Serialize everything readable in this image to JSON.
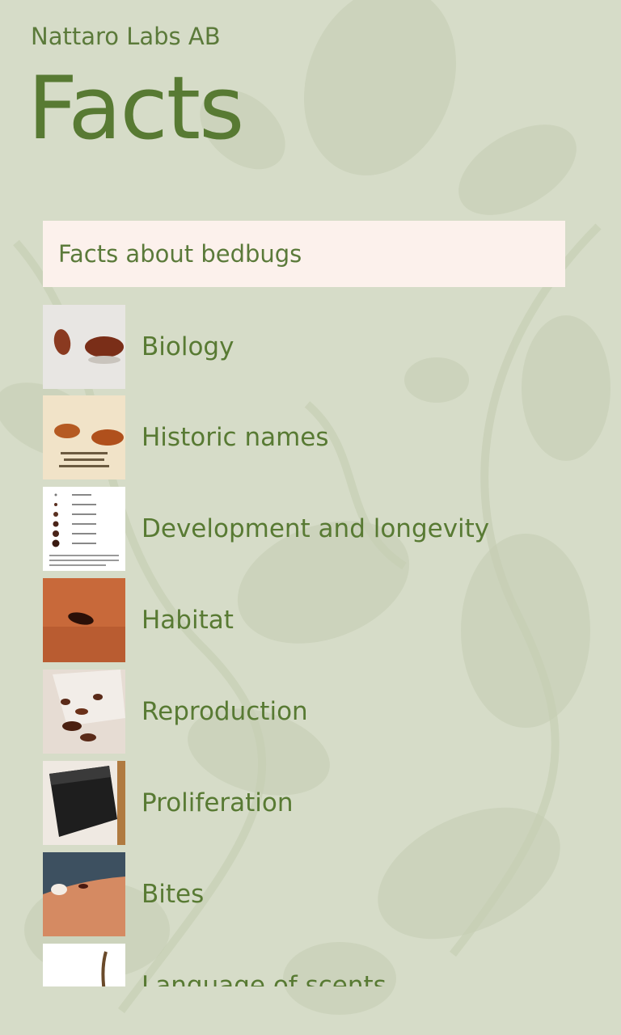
{
  "app": {
    "publisher": "Nattaro Labs AB",
    "title": "Facts"
  },
  "header_box": {
    "label": "Facts about bedbugs"
  },
  "items": [
    {
      "label": "Biology",
      "thumb": "bedbugs-photo"
    },
    {
      "label": "Historic names",
      "thumb": "bedbugs-with-caption"
    },
    {
      "label": "Development and longevity",
      "thumb": "lifecycle-chart"
    },
    {
      "label": "Habitat",
      "thumb": "bedbug-on-skin"
    },
    {
      "label": "Reproduction",
      "thumb": "bedbugs-cluster"
    },
    {
      "label": "Proliferation",
      "thumb": "suitcase"
    },
    {
      "label": "Bites",
      "thumb": "bedbug-on-arm"
    },
    {
      "label": "Language of scents",
      "thumb": "antenna-closeup"
    }
  ],
  "colors": {
    "accent": "#5b7a3a",
    "background": "#d6dcc8",
    "header_box": "#fcf1ec"
  }
}
